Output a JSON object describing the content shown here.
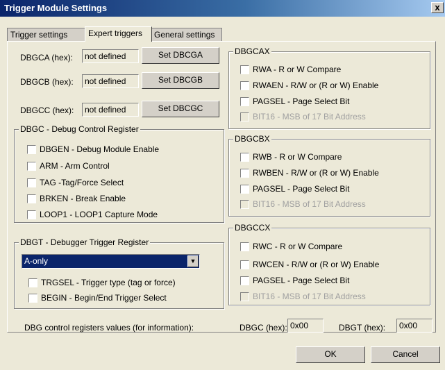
{
  "window": {
    "title": "Trigger Module Settings",
    "close_label": "x"
  },
  "tabs": [
    "Trigger settings",
    "Expert triggers",
    "General settings"
  ],
  "dbgca": {
    "label": "DBGCA (hex):",
    "value": "not defined",
    "button": "Set DBCGA"
  },
  "dbgcb": {
    "label": "DBGCB (hex):",
    "value": "not defined",
    "button": "Set DBCGB"
  },
  "dbgcc": {
    "label": "DBGCC (hex):",
    "value": "not defined",
    "button": "Set DBCGC"
  },
  "dbgc_group": {
    "title": "DBGC - Debug Control Register",
    "items": [
      "DBGEN - Debug Module Enable",
      "ARM - Arm Control",
      "TAG -Tag/Force Select",
      "BRKEN - Break Enable",
      "LOOP1 - LOOP1 Capture Mode"
    ]
  },
  "dbgt_group": {
    "title": "DBGT - Debugger Trigger Register",
    "select_value": "A-only",
    "items": [
      "TRGSEL - Trigger type (tag or force)",
      "BEGIN - Begin/End Trigger Select"
    ]
  },
  "dbgcax": {
    "title": "DBGCAX",
    "items": [
      "RWA - R or W Compare",
      "RWAEN - R/W or (R or W) Enable",
      "PAGSEL - Page Select Bit",
      "BIT16 - MSB of 17 Bit Address"
    ]
  },
  "dbgcbx": {
    "title": "DBGCBX",
    "items": [
      "RWB - R or W Compare",
      "RWBEN - R/W or (R or W) Enable",
      "PAGSEL - Page Select Bit",
      "BIT16 - MSB of 17 Bit Address"
    ]
  },
  "dbgccx": {
    "title": "DBGCCX",
    "items": [
      "RWC - R or W Compare",
      "RWCEN - R/W or (R or W) Enable",
      "PAGSEL - Page Select Bit",
      "BIT16 - MSB of 17 Bit Address"
    ]
  },
  "info": {
    "label": "DBG control registers values (for information):",
    "dbgc_label": "DBGC (hex):",
    "dbgc_value": "0x00",
    "dbgt_label": "DBGT (hex):",
    "dbgt_value": "0x00"
  },
  "footer": {
    "ok": "OK",
    "cancel": "Cancel"
  }
}
